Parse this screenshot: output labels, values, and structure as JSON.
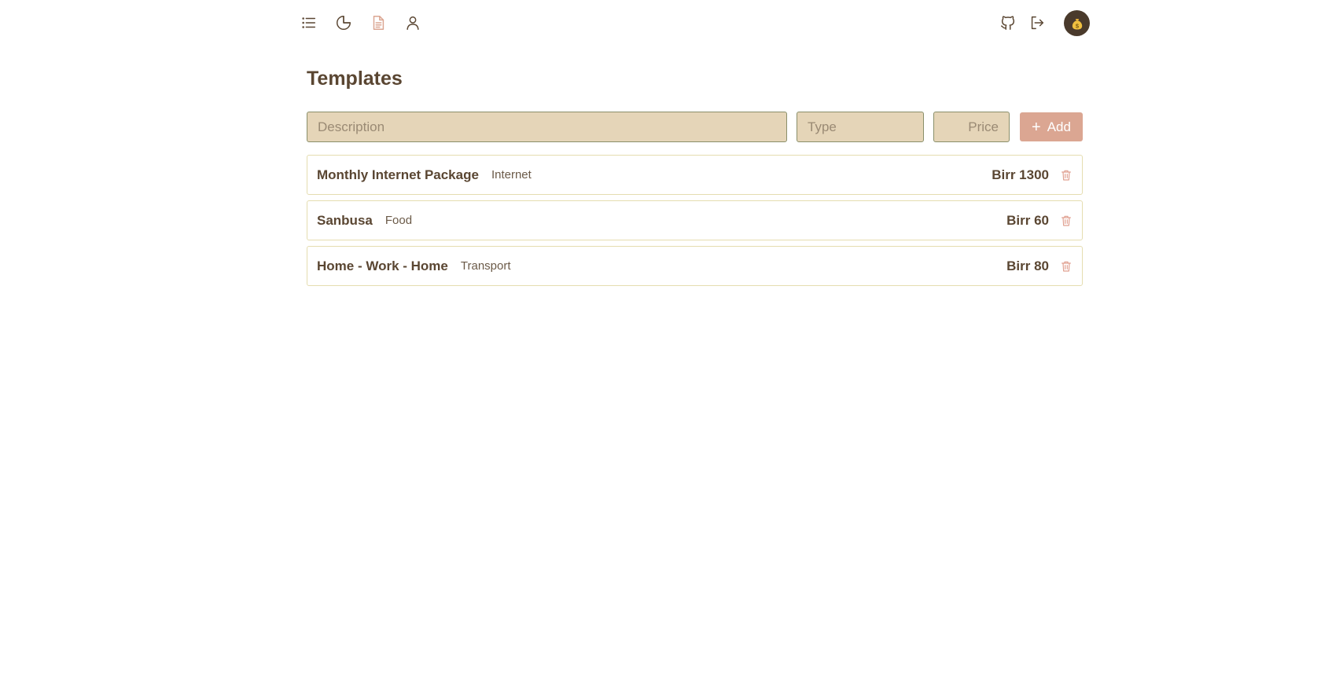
{
  "nav": {
    "left_icons": [
      "list-icon",
      "pie-chart-icon",
      "document-icon",
      "user-icon"
    ],
    "right_icons": [
      "github-icon",
      "logout-icon"
    ],
    "active_icon": "document-icon",
    "avatar_icon": "money-bag-icon"
  },
  "page": {
    "title": "Templates"
  },
  "form": {
    "description_placeholder": "Description",
    "type_placeholder": "Type",
    "price_placeholder": "Price",
    "add_label": "Add"
  },
  "templates": [
    {
      "description": "Monthly Internet Package",
      "type": "Internet",
      "price": "Birr 1300"
    },
    {
      "description": "Sanbusa",
      "type": "Food",
      "price": "Birr 60"
    },
    {
      "description": "Home - Work - Home",
      "type": "Transport",
      "price": "Birr 80"
    }
  ],
  "colors": {
    "text": "#5a4632",
    "accent": "#dba692",
    "input_bg": "#e5d5b8",
    "delete": "#e0a090"
  }
}
